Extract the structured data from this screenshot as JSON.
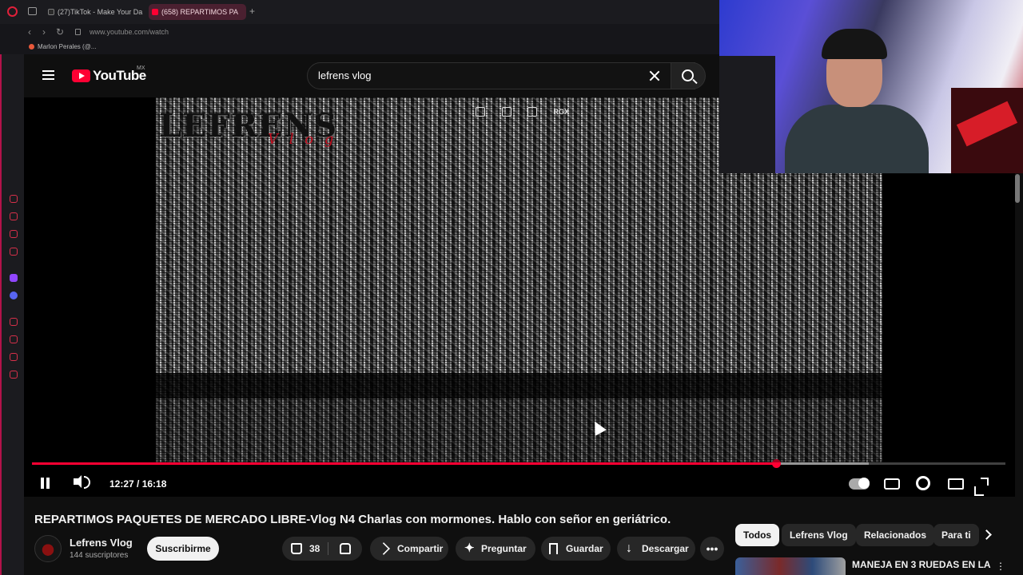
{
  "browser": {
    "tabs": [
      {
        "label": "(27)TikTok - Make Your Da",
        "active": false
      },
      {
        "label": "(658) REPARTIMOS PA",
        "active": true
      }
    ],
    "new_tab": "+",
    "url": "www.youtube.com/watch",
    "bookmark": "Marlon Perales (@..."
  },
  "youtube": {
    "logo_text": "YouTube",
    "region": "MX",
    "search": {
      "value": "lefrens vlog",
      "placeholder": "Buscar"
    }
  },
  "player": {
    "watermark": "LEFRENS",
    "watermark_sub": "V l o g",
    "overlay_label": "RGX",
    "current_time": "12:27",
    "duration": "16:18",
    "time_display": "12:27 / 16:18",
    "progress_fraction": 0.764,
    "buffer_fraction": 0.86
  },
  "video": {
    "title": "REPARTIMOS PAQUETES DE MERCADO LIBRE-Vlog N4 Charlas con mormones. Hablo con señor en geriátrico.",
    "channel": "Lefrens Vlog",
    "subscribers": "144 suscriptores",
    "subscribe_label": "Suscribirme",
    "likes": "38",
    "share_label": "Compartir",
    "ask_label": "Preguntar",
    "save_label": "Guardar",
    "download_label": "Descargar",
    "more_label": "•••"
  },
  "chips": [
    "Todos",
    "Lefrens Vlog",
    "Relacionados",
    "Para ti"
  ],
  "recommendation": {
    "title": "MANEJA EN 3 RUEDAS EN LA",
    "more": "⋮"
  },
  "colors": {
    "accent": "#ff0033",
    "background": "#0f0f0f",
    "opera_red": "#e0203a"
  }
}
